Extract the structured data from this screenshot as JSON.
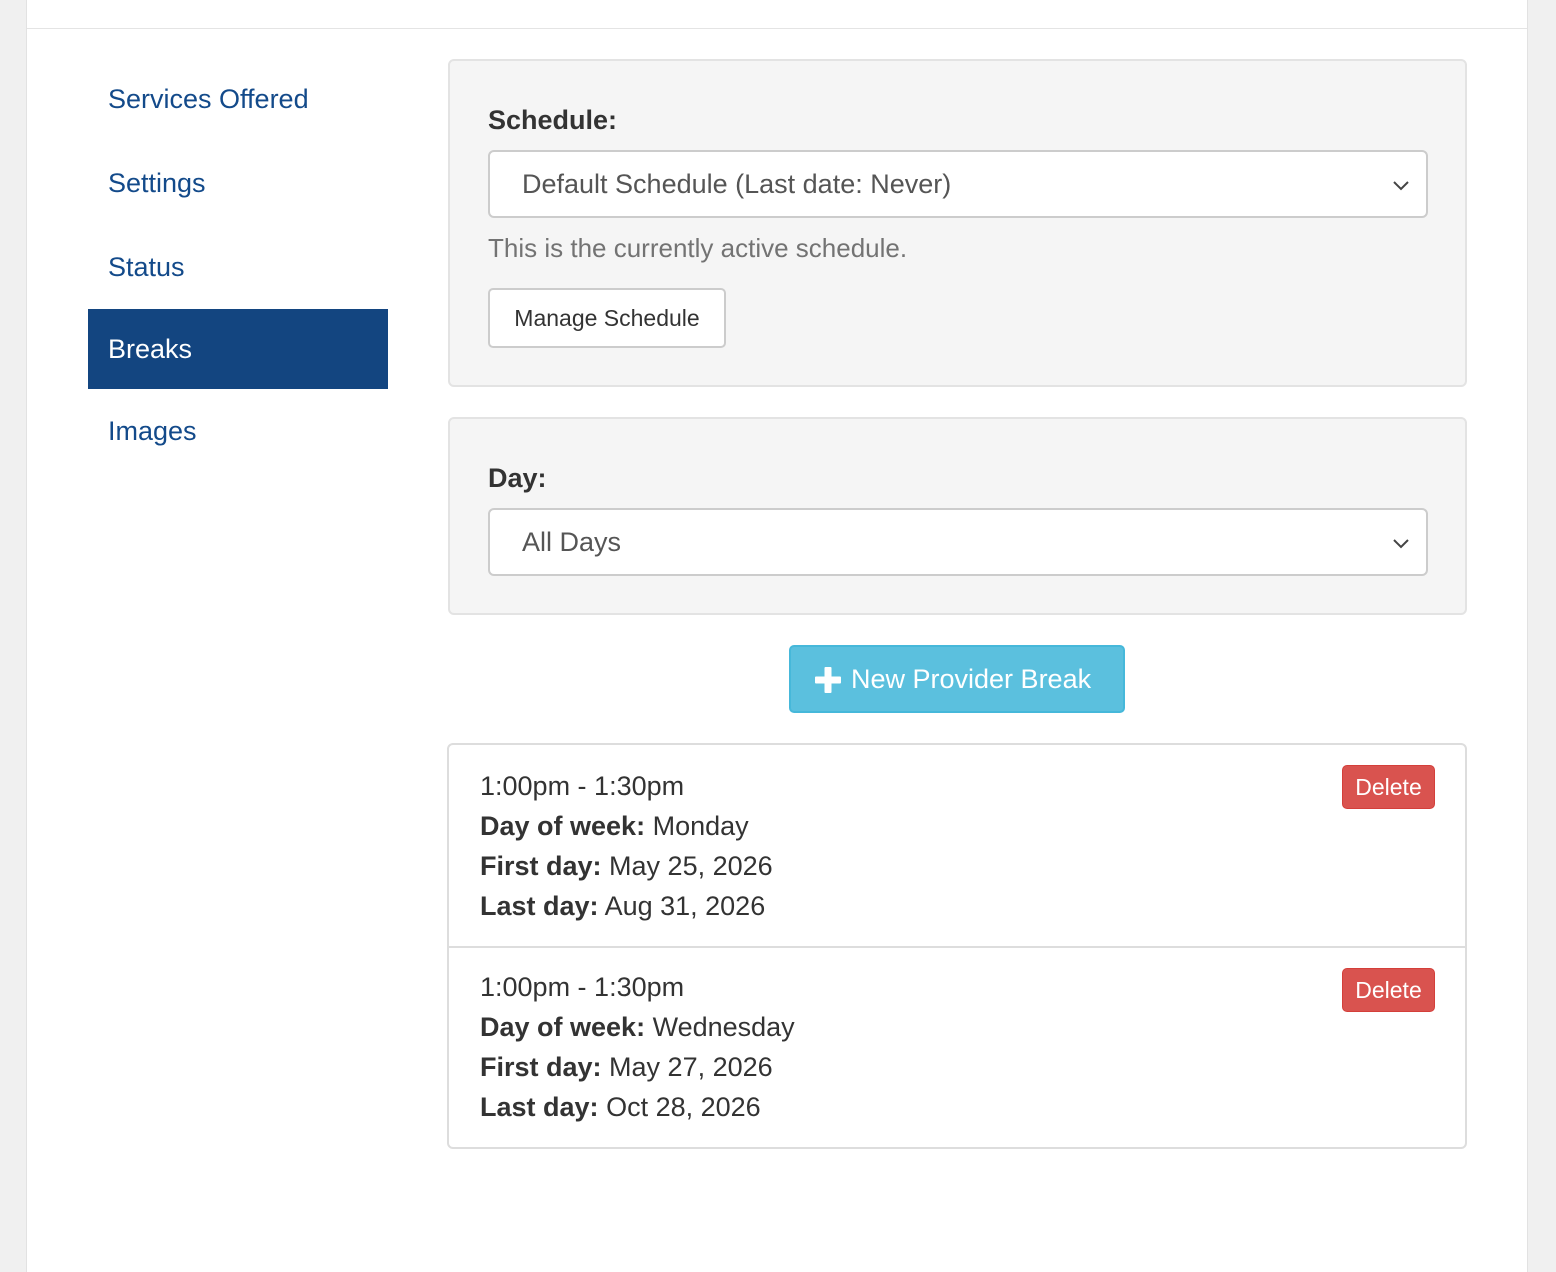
{
  "sidebar": {
    "items": [
      {
        "label": "Services Offered"
      },
      {
        "label": "Settings"
      },
      {
        "label": "Status"
      },
      {
        "label": "Breaks",
        "active": true
      },
      {
        "label": "Images"
      }
    ]
  },
  "schedule": {
    "label": "Schedule:",
    "selected": "Default Schedule (Last date: Never)",
    "help": "This is the currently active schedule.",
    "manage_label": "Manage Schedule"
  },
  "day": {
    "label": "Day:",
    "selected": "All Days"
  },
  "new_break_label": "New Provider Break",
  "breaks": [
    {
      "time": "1:00pm - 1:30pm",
      "dow_label": "Day of week:",
      "dow": "Monday",
      "first_label": "First day:",
      "first": "May 25, 2026",
      "last_label": "Last day:",
      "last": "Aug 31, 2026",
      "delete_label": "Delete"
    },
    {
      "time": "1:00pm - 1:30pm",
      "dow_label": "Day of week:",
      "dow": "Wednesday",
      "first_label": "First day:",
      "first": "May 27, 2026",
      "last_label": "Last day:",
      "last": "Oct 28, 2026",
      "delete_label": "Delete"
    }
  ],
  "colors": {
    "nav_link": "#134a8a",
    "nav_active_bg": "#134580",
    "info_button": "#5bc0de",
    "danger_button": "#d9534f"
  }
}
